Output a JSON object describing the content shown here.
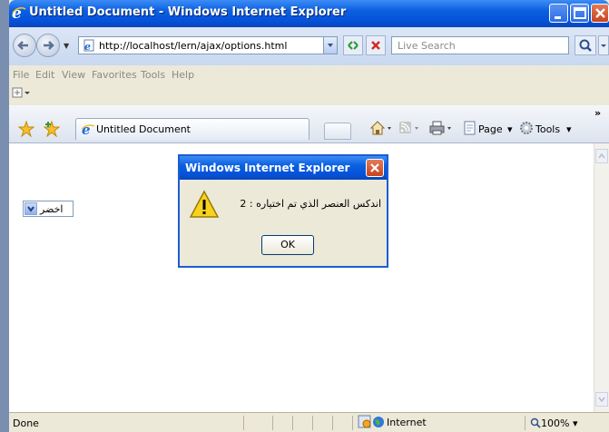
{
  "window": {
    "title": "Untitled Document - Windows Internet Explorer"
  },
  "address": {
    "url": "http://localhost/lern/ajax/options.html"
  },
  "search": {
    "placeholder": "Live Search"
  },
  "menu": {
    "items": [
      "File",
      "Edit",
      "View",
      "Favorites",
      "Tools",
      "Help"
    ]
  },
  "tab": {
    "title": "Untitled Document"
  },
  "commands": {
    "page": "Page",
    "tools": "Tools"
  },
  "content": {
    "select_value": "اخضر"
  },
  "dialog": {
    "title": "Windows Internet Explorer",
    "message": "اندكس العنصر الذي تم اختياره : 2",
    "ok_label": "OK"
  },
  "status": {
    "text": "Done",
    "zone": "Internet",
    "zoom": "100%"
  },
  "icons": {
    "title": "ie-logo-icon",
    "back": "back-arrow-icon",
    "forward": "forward-arrow-icon",
    "refresh": "refresh-icon",
    "stop": "stop-icon",
    "search": "search-icon",
    "home": "home-icon",
    "feeds": "rss-feed-icon",
    "print": "print-icon",
    "warning": "warning-icon",
    "globe": "globe-icon"
  }
}
